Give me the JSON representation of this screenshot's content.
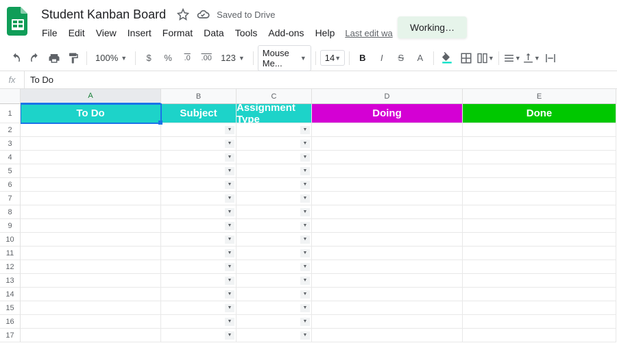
{
  "doc": {
    "title": "Student Kanban Board",
    "saved_text": "Saved to Drive",
    "last_edit": "Last edit wa",
    "working": "Working…"
  },
  "menus": [
    "File",
    "Edit",
    "View",
    "Insert",
    "Format",
    "Data",
    "Tools",
    "Add-ons",
    "Help"
  ],
  "toolbar": {
    "zoom": "100%",
    "currency": "$",
    "percent": "%",
    "dec_dec": ".0",
    "dec_inc": ".00",
    "more_formats": "123",
    "font": "Mouse Me...",
    "font_size": "14",
    "bold": "B",
    "italic": "I",
    "strike": "S",
    "textcolor": "A"
  },
  "formula": {
    "fx": "fx",
    "value": "To Do"
  },
  "columns": [
    "A",
    "B",
    "C",
    "D",
    "E"
  ],
  "rows": [
    "1",
    "2",
    "3",
    "4",
    "5",
    "6",
    "7",
    "8",
    "9",
    "10",
    "11",
    "12",
    "13",
    "14",
    "15",
    "16",
    "17"
  ],
  "headers": {
    "todo": {
      "label": "To Do",
      "bg": "#1dd3c9"
    },
    "subject": {
      "label": "Subject",
      "bg": "#1dd3c9"
    },
    "atype": {
      "label": "Assignment Type",
      "bg": "#1dd3c9"
    },
    "doing": {
      "label": "Doing",
      "bg": "#d400d4"
    },
    "done": {
      "label": "Done",
      "bg": "#00c800"
    }
  },
  "selected_col": "A"
}
